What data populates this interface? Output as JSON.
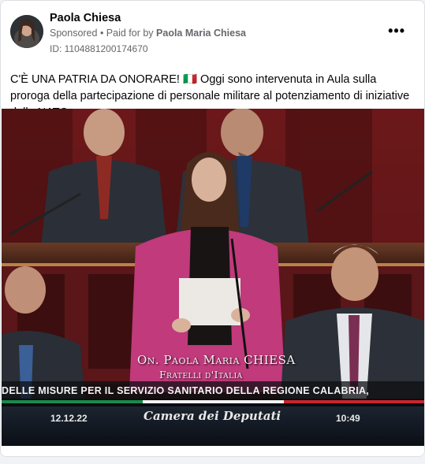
{
  "post": {
    "author": "Paola Chiesa",
    "sponsored": "Sponsored",
    "paid_for_prefix": " • Paid for by ",
    "paid_for_by": "Paola Maria Chiesa",
    "library_id": "ID: 1104881200174670",
    "more_icon": "more-options-icon",
    "text": "C'È UNA PATRIA DA ONORARE! 🇮🇹 Oggi sono intervenuta in Aula sulla proroga della partecipazione di personale militare al potenziamento di iniziative della NATO."
  },
  "video": {
    "speaker_name": "On. Paola Maria CHIESA",
    "speaker_party": "Fratelli d'Italia",
    "ticker": "DELLE MISURE PER IL SERVIZIO SANITARIO DELLA REGIONE CALABRIA,",
    "date": "12.12.22",
    "channel": "Camera dei Deputati",
    "time": "10:49"
  }
}
